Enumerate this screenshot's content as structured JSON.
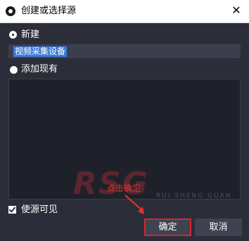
{
  "window": {
    "title": "创建或选择源",
    "close_glyph": "✕"
  },
  "options": {
    "create_new_label": "新建",
    "add_existing_label": "添加现有",
    "name_value": "视频采集设备"
  },
  "visible_checkbox": {
    "label": "使源可见",
    "checked": true
  },
  "buttons": {
    "ok_label": "确定",
    "cancel_label": "取消"
  },
  "annotation": {
    "text": "点击确定",
    "color": "#e6332a"
  },
  "watermark": {
    "brand": "RSG",
    "subtitle": "RUI SHENG GUAN"
  },
  "colors": {
    "background": "#2b2e38",
    "list_background": "#1f212a",
    "selection": "#3d7bd8",
    "highlight_border": "#d9262c"
  }
}
